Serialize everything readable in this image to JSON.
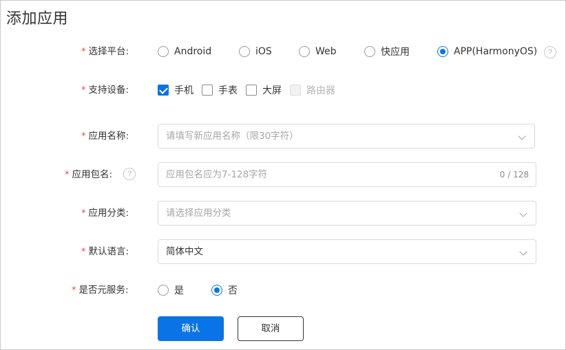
{
  "page": {
    "title": "添加应用"
  },
  "form": {
    "platform": {
      "required_mark": "*",
      "label": "选择平台:",
      "options": [
        "Android",
        "iOS",
        "Web",
        "快应用",
        "APP(HarmonyOS)"
      ],
      "selected": "APP(HarmonyOS)",
      "help_icon": "question-circle-icon"
    },
    "devices": {
      "required_mark": "*",
      "label": "支持设备:",
      "options": [
        {
          "label": "手机",
          "checked": true,
          "disabled": false
        },
        {
          "label": "手表",
          "checked": false,
          "disabled": false
        },
        {
          "label": "大屏",
          "checked": false,
          "disabled": false
        },
        {
          "label": "路由器",
          "checked": false,
          "disabled": true
        }
      ]
    },
    "app_name": {
      "required_mark": "*",
      "label": "应用名称:",
      "placeholder": "请填写新应用名称（限30字符）",
      "icon": "chevron-down-icon"
    },
    "package_name": {
      "required_mark": "*",
      "label": "应用包名:",
      "placeholder": "应用包名应为7-128字符",
      "counter": "0 / 128",
      "help_icon": "question-circle-icon"
    },
    "category": {
      "required_mark": "*",
      "label": "应用分类:",
      "placeholder": "请选择应用分类",
      "icon": "chevron-down-icon"
    },
    "language": {
      "required_mark": "*",
      "label": "默认语言:",
      "value": "简体中文",
      "icon": "chevron-down-icon"
    },
    "meta_service": {
      "required_mark": "*",
      "label": "是否元服务:",
      "options": [
        "是",
        "否"
      ],
      "selected": "否"
    }
  },
  "actions": {
    "confirm_label": "确认",
    "cancel_label": "取消"
  },
  "colors": {
    "accent": "#0a74e6",
    "required": "#e84c3d",
    "border": "#d9d9d9"
  }
}
